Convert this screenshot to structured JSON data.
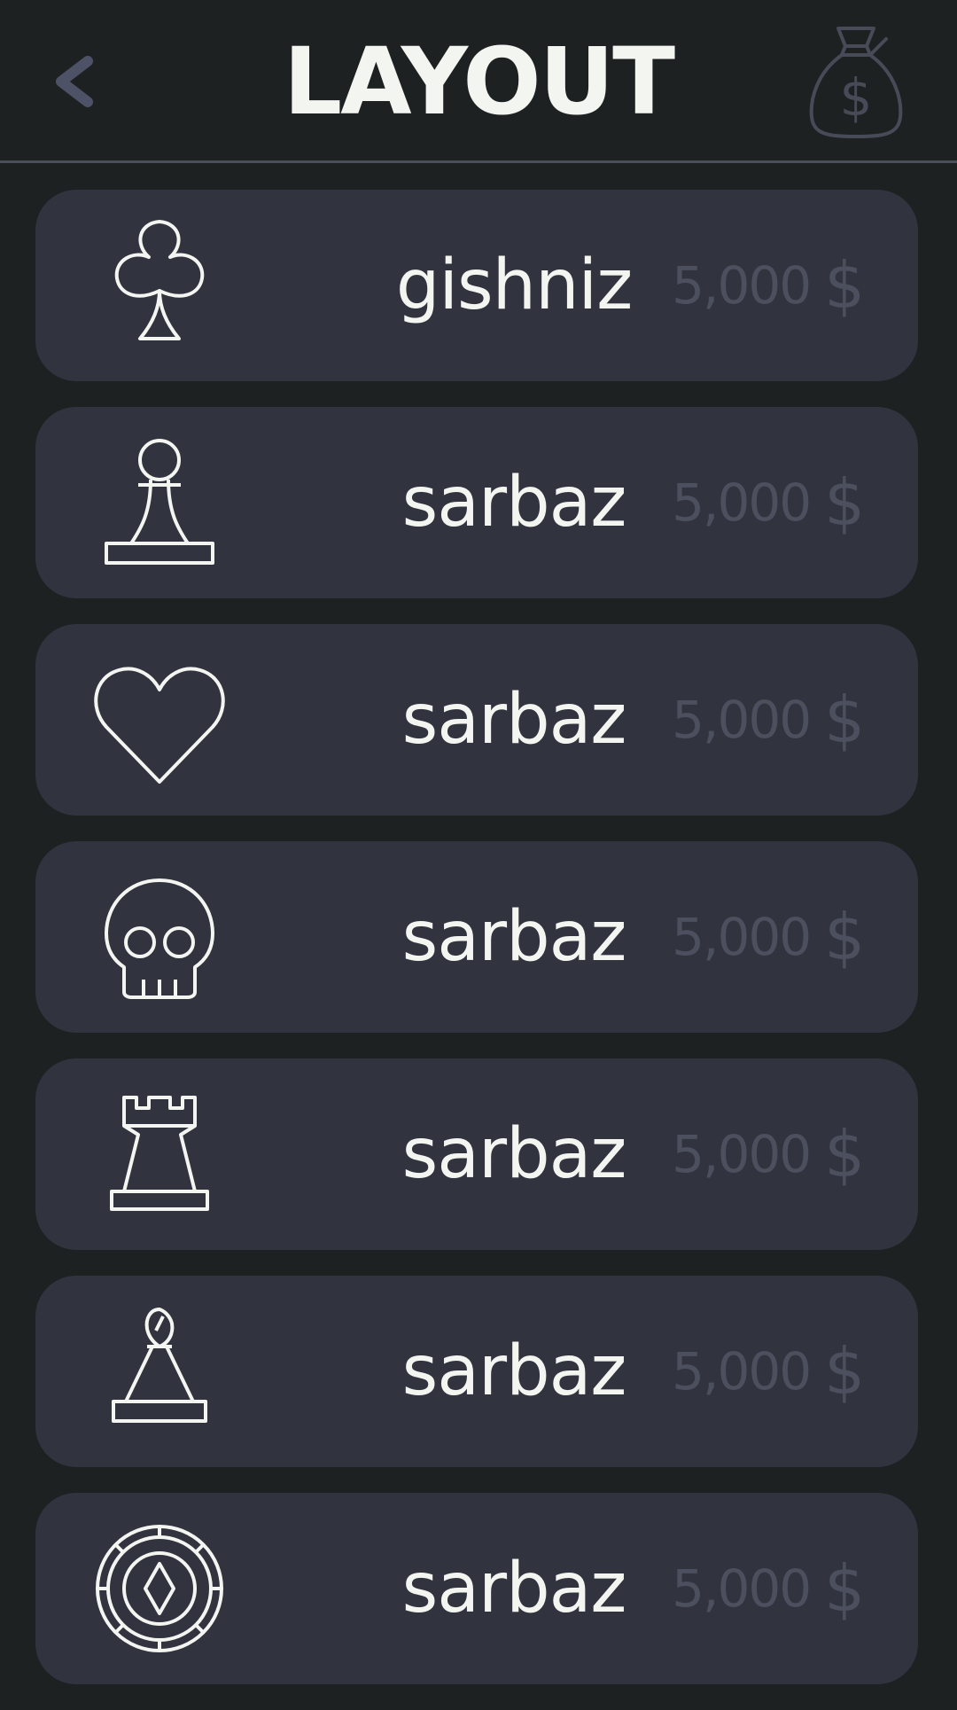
{
  "header": {
    "title": "LAYOUT",
    "back_icon": "chevron-left-icon",
    "wallet_icon": "money-bag-icon"
  },
  "colors": {
    "background": "#1d2121",
    "card": "#31333f",
    "text": "#f2f5f0",
    "muted": "#4c4f5d",
    "divider": "#4a4d5a"
  },
  "items": [
    {
      "icon": "club-icon",
      "name": "gishniz",
      "price": "5,000",
      "currency": "$"
    },
    {
      "icon": "pawn-icon",
      "name": "sarbaz",
      "price": "5,000",
      "currency": "$"
    },
    {
      "icon": "heart-icon",
      "name": "sarbaz",
      "price": "5,000",
      "currency": "$"
    },
    {
      "icon": "skull-icon",
      "name": "sarbaz",
      "price": "5,000",
      "currency": "$"
    },
    {
      "icon": "rook-icon",
      "name": "sarbaz",
      "price": "5,000",
      "currency": "$"
    },
    {
      "icon": "bishop-icon",
      "name": "sarbaz",
      "price": "5,000",
      "currency": "$"
    },
    {
      "icon": "poker-chip-icon",
      "name": "sarbaz",
      "price": "5,000",
      "currency": "$"
    }
  ]
}
